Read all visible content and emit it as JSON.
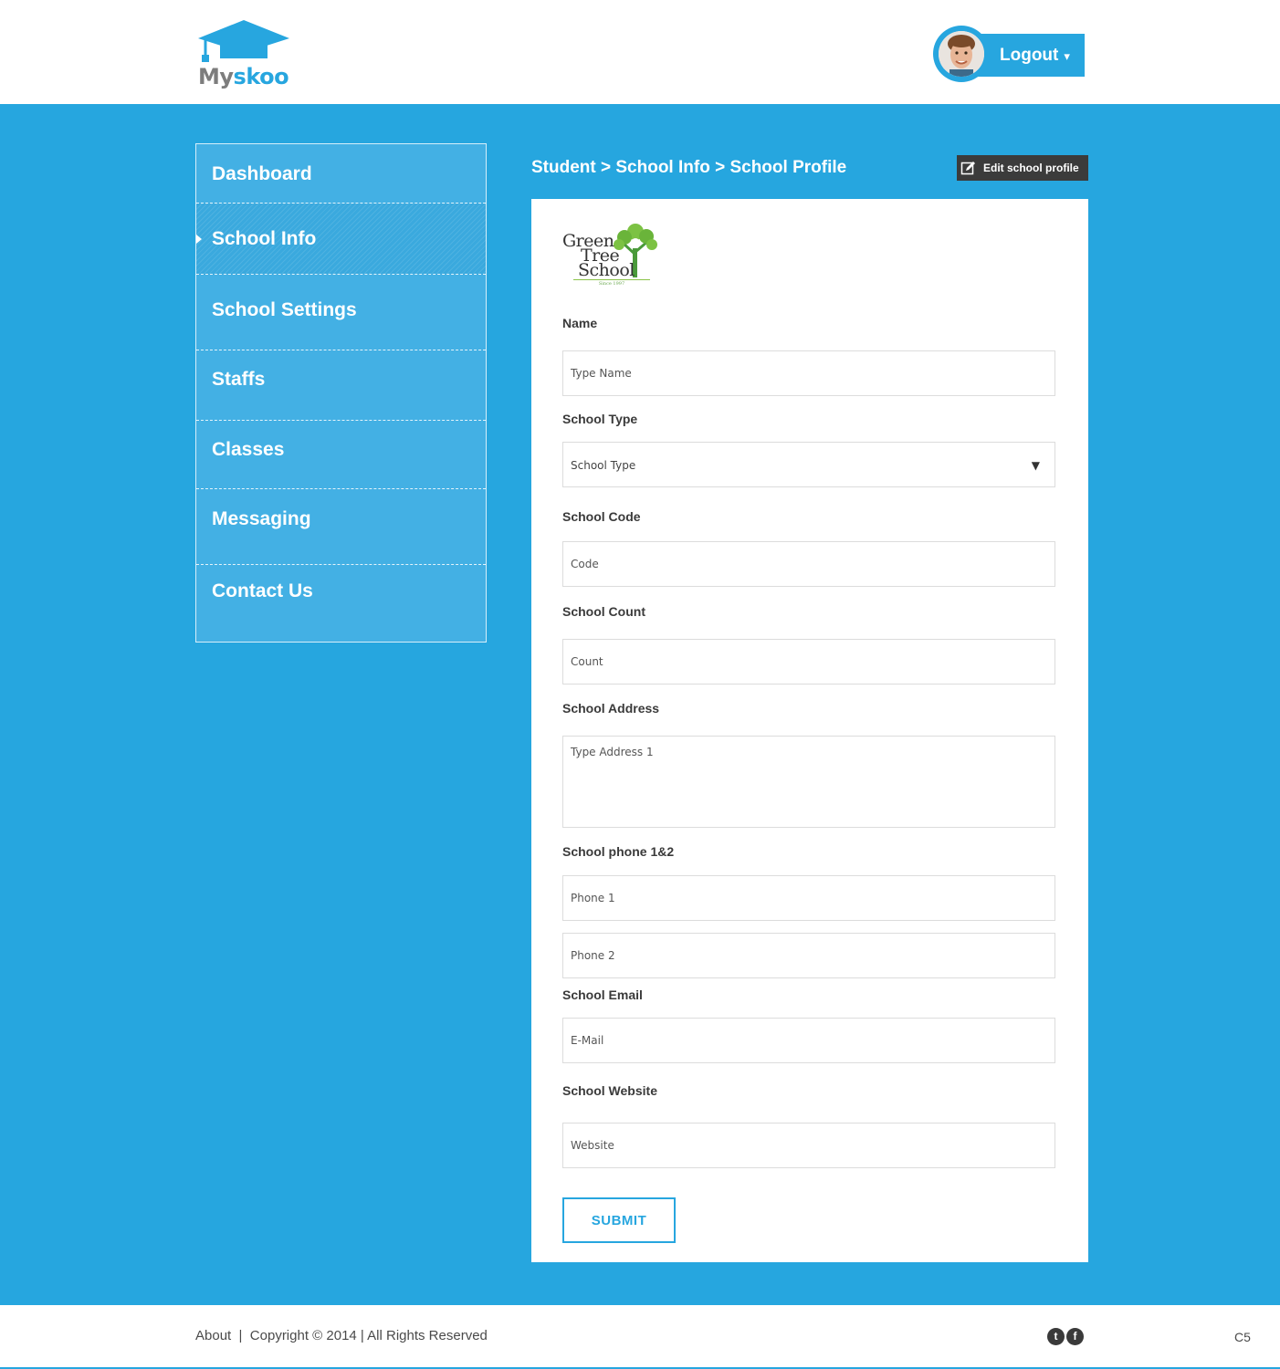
{
  "header": {
    "logo": {
      "part1": "My",
      "part2": "skoo"
    },
    "logout_label": "Logout",
    "logout_caret": "▾"
  },
  "sidebar": {
    "items": [
      {
        "label": "Dashboard"
      },
      {
        "label": "School Info"
      },
      {
        "label": "School Settings"
      },
      {
        "label": "Staffs"
      },
      {
        "label": "Classes"
      },
      {
        "label": "Messaging"
      },
      {
        "label": "Contact Us"
      }
    ],
    "active_index": 1
  },
  "breadcrumb": "Student > School Info > School Profile",
  "edit_button_label": "Edit school profile",
  "school_logo": {
    "line1": "Green",
    "line2": "Tree",
    "line3": "School",
    "since": "Since 1997"
  },
  "form": {
    "name": {
      "label": "Name",
      "placeholder": "Type Name"
    },
    "school_type": {
      "label": "School Type",
      "value": "School Type",
      "caret": "▼"
    },
    "school_code": {
      "label": "School Code",
      "placeholder": "Code"
    },
    "school_count": {
      "label": "School Count",
      "placeholder": "Count"
    },
    "school_address": {
      "label": "School Address",
      "placeholder": "Type Address 1"
    },
    "school_phone": {
      "label": "School phone 1&2",
      "placeholder1": "Phone 1",
      "placeholder2": "Phone 2"
    },
    "school_email": {
      "label": "School Email",
      "placeholder": "E-Mail"
    },
    "school_website": {
      "label": "School Website",
      "placeholder": "Website"
    },
    "submit_label": "SUBMIT"
  },
  "footer": {
    "about": "About",
    "separator": "|",
    "copyright": "Copyright © 2014 | All Rights Reserved",
    "social": [
      {
        "icon": "twitter-icon",
        "glyph": "t"
      },
      {
        "icon": "facebook-icon",
        "glyph": "f"
      }
    ],
    "code": "C5"
  },
  "colors": {
    "brand_blue": "#27a6df",
    "sidebar_blue": "#43b0e4",
    "dark_button": "#3b3b3b"
  }
}
